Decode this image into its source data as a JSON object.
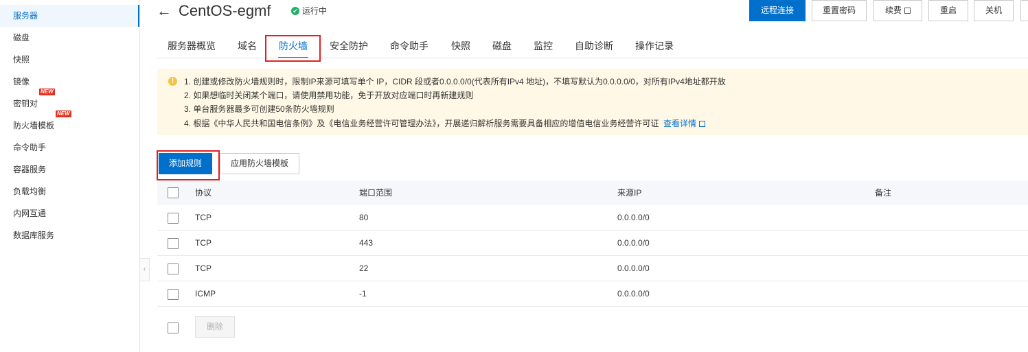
{
  "sidebar": {
    "items": [
      {
        "label": "服务器",
        "active": true,
        "badge": ""
      },
      {
        "label": "磁盘",
        "active": false,
        "badge": ""
      },
      {
        "label": "快照",
        "active": false,
        "badge": ""
      },
      {
        "label": "镜像",
        "active": false,
        "badge": ""
      },
      {
        "label": "密钥对",
        "active": false,
        "badge": "NEW"
      },
      {
        "label": "防火墙模板",
        "active": false,
        "badge": "NEW"
      },
      {
        "label": "命令助手",
        "active": false,
        "badge": ""
      },
      {
        "label": "容器服务",
        "active": false,
        "badge": ""
      },
      {
        "label": "负载均衡",
        "active": false,
        "badge": ""
      },
      {
        "label": "内网互通",
        "active": false,
        "badge": ""
      },
      {
        "label": "数据库服务",
        "active": false,
        "badge": ""
      }
    ],
    "collapse_glyph": "‹"
  },
  "header": {
    "back_glyph": "←",
    "title": "CentOS-egmf",
    "status": "运行中",
    "status_glyph": "✔",
    "buttons": {
      "remote": "远程连接",
      "reset_password": "重置密码",
      "renew": "续费",
      "restart": "重启",
      "shutdown": "关机"
    }
  },
  "tabs": [
    "服务器概览",
    "域名",
    "防火墙",
    "安全防护",
    "命令助手",
    "快照",
    "磁盘",
    "监控",
    "自助诊断",
    "操作记录"
  ],
  "active_tab": "防火墙",
  "notice": {
    "icon_glyph": "!",
    "lines": [
      "1. 创建或修改防火墙规则时，限制IP来源可填写单个 IP，CIDR 段或者0.0.0.0/0(代表所有IPv4 地址)，不填写默认为0.0.0.0/0，对所有IPv4地址都开放",
      "2. 如果想临时关闭某个端口，请使用禁用功能，免于开放对应端口时再新建规则",
      "3. 单台服务器最多可创建50条防火墙规则",
      "4. 根据《中华人民共和国电信条例》及《电信业务经营许可管理办法》，开展递归解析服务需要具备相应的增值电信业务经营许可证"
    ],
    "link": "查看详情"
  },
  "actions": {
    "add_rule": "添加规则",
    "apply_template": "应用防火墙模板"
  },
  "table": {
    "columns": [
      "协议",
      "端口范围",
      "来源IP",
      "备注"
    ],
    "rows": [
      {
        "protocol": "TCP",
        "port": "80",
        "source": "0.0.0.0/0",
        "note": ""
      },
      {
        "protocol": "TCP",
        "port": "443",
        "source": "0.0.0.0/0",
        "note": ""
      },
      {
        "protocol": "TCP",
        "port": "22",
        "source": "0.0.0.0/0",
        "note": ""
      },
      {
        "protocol": "ICMP",
        "port": "-1",
        "source": "0.0.0.0/0",
        "note": ""
      }
    ],
    "delete_label": "删除"
  },
  "colors": {
    "accent": "#0070cc",
    "notice_bg": "#fff8e6",
    "highlight_box": "#e02020",
    "status_ok": "#23b066"
  }
}
